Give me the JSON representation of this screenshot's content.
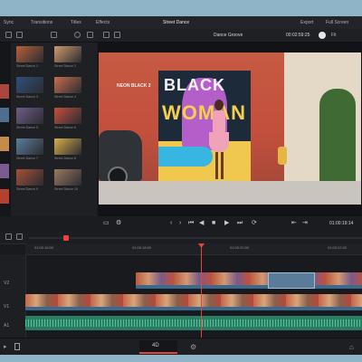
{
  "app": {
    "project_title": "Street Dance",
    "left_toolbar": [
      "Sync",
      "Transitions",
      "Titles",
      "Effects"
    ],
    "right_toolbar": [
      "Export",
      "Full Screen"
    ]
  },
  "viewer": {
    "clip_name": "Dance Groove",
    "timecode": "00:02:59:25",
    "zoom": "Fit",
    "playhead_timecode": "01:00:19:14",
    "scene_text": [
      "BLACK",
      "WOMAN",
      "NEON BLACK 2"
    ]
  },
  "media_pool": {
    "items": [
      {
        "label": "Street Dance 1",
        "color": "#b8603a"
      },
      {
        "label": "Street Dance 2",
        "color": "#cf9a6b"
      },
      {
        "label": "Street Dance 3",
        "color": "#2f4f7a"
      },
      {
        "label": "Street Dance 4",
        "color": "#c86d4b"
      },
      {
        "label": "Street Dance 5",
        "color": "#6f5d88"
      },
      {
        "label": "Street Dance 6",
        "color": "#c44f3d"
      },
      {
        "label": "Street Dance 7",
        "color": "#5c7e9c"
      },
      {
        "label": "Street Dance 8",
        "color": "#d7af4a"
      },
      {
        "label": "Street Dance 9",
        "color": "#a55037"
      },
      {
        "label": "Street Dance 10",
        "color": "#9a7a60"
      }
    ]
  },
  "timeline": {
    "ruler": [
      "01:00:16:00",
      "01:00:18:00",
      "01:00:20:00",
      "01:00:22:00"
    ],
    "tracks": [
      "V2",
      "V1",
      "A1"
    ]
  },
  "bottom": {
    "center_label": "4D"
  },
  "colors": {
    "accent_red": "#e5453a",
    "accent_blue": "#2f8cff",
    "audio_green": "#2a7c63",
    "video_track": "#3b6a8f"
  }
}
